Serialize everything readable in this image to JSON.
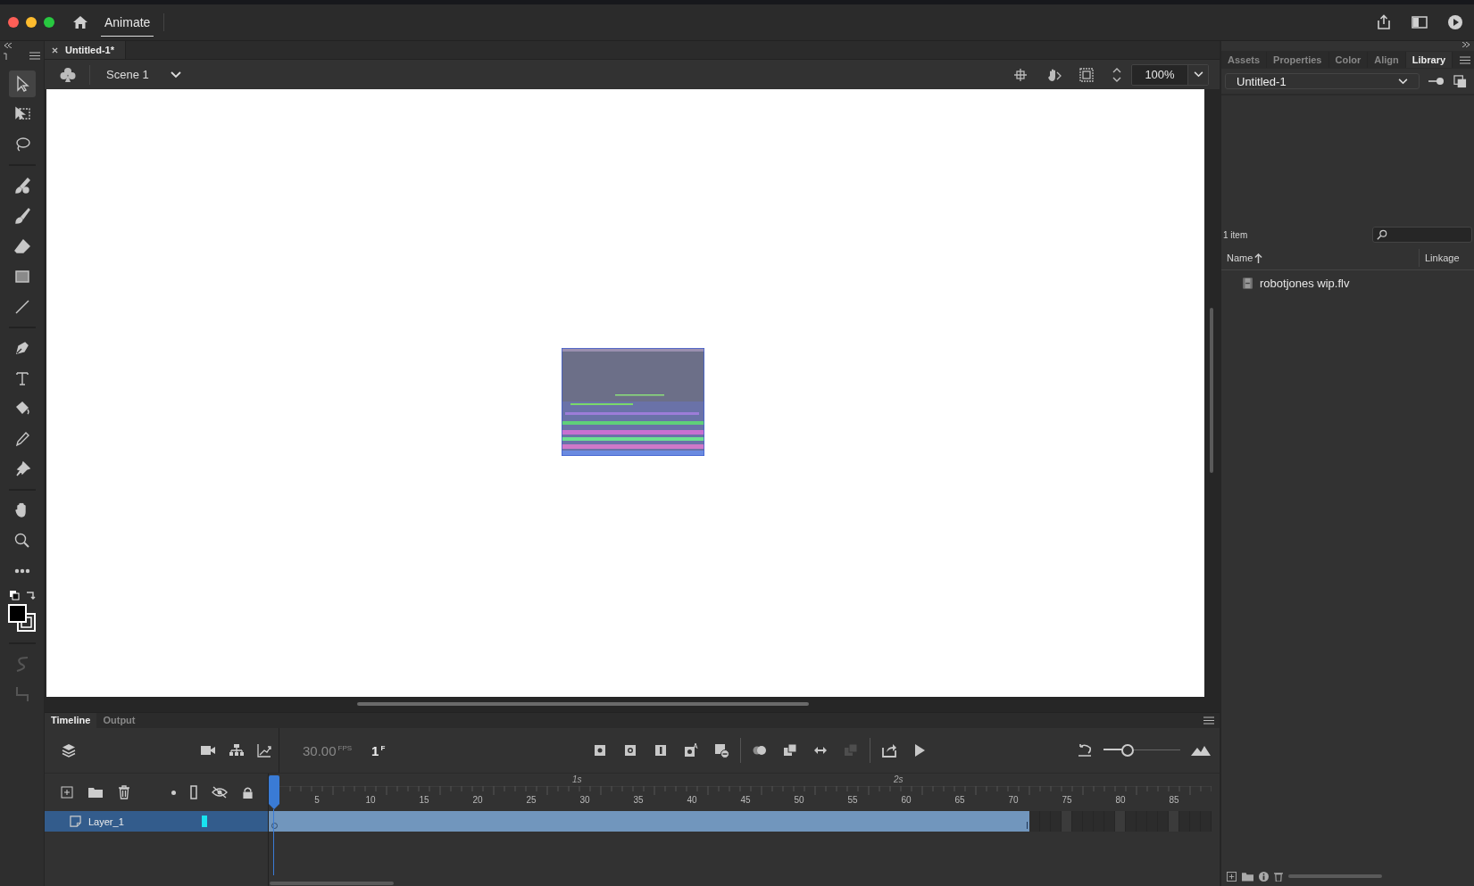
{
  "window": {
    "app_tab": "Animate"
  },
  "document_tabs": [
    {
      "title": "Untitled-1*",
      "selected": true
    }
  ],
  "scene": {
    "name": "Scene 1"
  },
  "zoom": {
    "value": "100%"
  },
  "tool_groups": [
    [
      {
        "kind": "select",
        "selected": true,
        "disabled": false
      },
      {
        "kind": "transform",
        "selected": false,
        "disabled": false
      },
      {
        "kind": "lasso",
        "selected": false,
        "disabled": false
      }
    ],
    [
      {
        "kind": "fluid-brush",
        "selected": false,
        "disabled": false
      },
      {
        "kind": "brush",
        "selected": false,
        "disabled": false
      },
      {
        "kind": "eraser",
        "selected": false,
        "disabled": false
      },
      {
        "kind": "rectangle",
        "selected": false,
        "disabled": false
      },
      {
        "kind": "line",
        "selected": false,
        "disabled": false
      }
    ],
    [
      {
        "kind": "pen",
        "selected": false,
        "disabled": false
      },
      {
        "kind": "text",
        "selected": false,
        "disabled": false
      },
      {
        "kind": "bucket",
        "selected": false,
        "disabled": false
      },
      {
        "kind": "eyedropper",
        "selected": false,
        "disabled": false
      },
      {
        "kind": "pin",
        "selected": false,
        "disabled": false
      }
    ],
    [
      {
        "kind": "hand",
        "selected": false,
        "disabled": false
      },
      {
        "kind": "zoom",
        "selected": false,
        "disabled": false
      },
      {
        "kind": "more",
        "selected": false,
        "disabled": false
      }
    ],
    [
      {
        "kind": "smooth",
        "selected": false,
        "disabled": true
      },
      {
        "kind": "straighten",
        "selected": false,
        "disabled": true
      }
    ]
  ],
  "stage": {
    "content": {
      "kind": "picture"
    }
  },
  "right_panel": {
    "tabs": [
      {
        "label": "Assets",
        "selected": false
      },
      {
        "label": "Properties",
        "selected": false
      },
      {
        "label": "Color",
        "selected": false
      },
      {
        "label": "Align",
        "selected": false
      },
      {
        "label": "Library",
        "selected": true
      }
    ],
    "library": {
      "document": "Untitled-1",
      "count": "1 item",
      "columns": [
        "Name",
        "Linkage"
      ],
      "items": [
        {
          "name": "robotjones wip.flv"
        }
      ]
    }
  },
  "timeline": {
    "tabs": [
      {
        "label": "Timeline",
        "selected": true
      },
      {
        "label": "Output",
        "selected": false
      }
    ],
    "fps": "30.00",
    "fps_unit": "FPS",
    "frame": "1",
    "frame_unit": "F",
    "buttons": [
      {
        "kind": "keyframe",
        "disabled": false
      },
      {
        "kind": "blank-keyframe",
        "disabled": false
      },
      {
        "kind": "frame",
        "disabled": false
      },
      {
        "kind": "auto-keyframe",
        "disabled": false
      },
      {
        "kind": "remove-frame",
        "disabled": false
      },
      {
        "kind": "onion",
        "disabled": false
      },
      {
        "kind": "edit-multiple",
        "disabled": false
      },
      {
        "kind": "loop",
        "disabled": false
      },
      {
        "kind": "swap",
        "disabled": true
      },
      {
        "kind": "export",
        "disabled": false
      },
      {
        "kind": "play",
        "disabled": false
      }
    ],
    "frame_zoom": {
      "level": 0.3
    },
    "seconds": [
      "1s",
      "2s"
    ],
    "frame_labels": [
      "5",
      "10",
      "15",
      "20",
      "25",
      "30",
      "35",
      "40",
      "45",
      "50",
      "55",
      "60",
      "65",
      "70",
      "75",
      "80",
      "85"
    ],
    "layers": [
      {
        "name": "Layer_1",
        "selected": true,
        "color": "#19e3f0"
      }
    ]
  }
}
